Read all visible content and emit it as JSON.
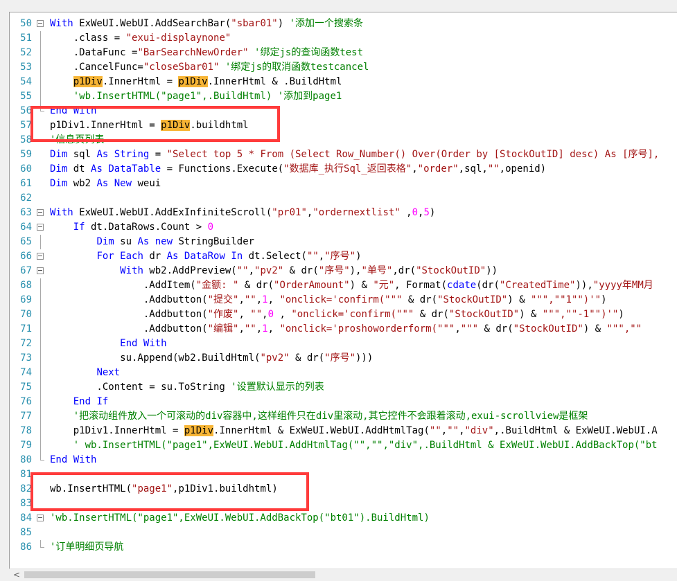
{
  "editor": {
    "lines": [
      {
        "n": "50",
        "fold": "box",
        "segs": [
          {
            "t": "With",
            "c": "kw"
          },
          {
            "t": " ExWeUI.WebUI.AddSearchBar(",
            "c": "pl"
          },
          {
            "t": "\"sbar01\"",
            "c": "str"
          },
          {
            "t": ") ",
            "c": "pl"
          },
          {
            "t": "'添加一个搜索条",
            "c": "com"
          }
        ]
      },
      {
        "n": "51",
        "fold": "line",
        "segs": [
          {
            "t": "    .class = ",
            "c": "pl"
          },
          {
            "t": "\"exui-displaynone\"",
            "c": "str"
          }
        ]
      },
      {
        "n": "52",
        "fold": "line",
        "segs": [
          {
            "t": "    .DataFunc =",
            "c": "pl"
          },
          {
            "t": "\"BarSearchNewOrder\"",
            "c": "str"
          },
          {
            "t": " ",
            "c": "pl"
          },
          {
            "t": "'绑定js的查询函数test",
            "c": "com"
          }
        ]
      },
      {
        "n": "53",
        "fold": "line",
        "segs": [
          {
            "t": "    .CancelFunc=",
            "c": "pl"
          },
          {
            "t": "\"closeSbar01\"",
            "c": "str"
          },
          {
            "t": " ",
            "c": "pl"
          },
          {
            "t": "'绑定js的取消函数testcancel",
            "c": "com"
          }
        ]
      },
      {
        "n": "54",
        "fold": "line",
        "segs": [
          {
            "t": "    ",
            "c": "pl"
          },
          {
            "t": "p1Div",
            "c": "hl"
          },
          {
            "t": ".InnerHtml = ",
            "c": "pl"
          },
          {
            "t": "p1Div",
            "c": "hl"
          },
          {
            "t": ".InnerHtml & .BuildHtml",
            "c": "pl"
          }
        ]
      },
      {
        "n": "55",
        "fold": "line",
        "segs": [
          {
            "t": "    ",
            "c": "pl"
          },
          {
            "t": "'wb.InsertHTML(\"page1\",.BuildHtml) '添加到page1",
            "c": "com"
          }
        ]
      },
      {
        "n": "56",
        "fold": "end",
        "segs": [
          {
            "t": "End",
            "c": "kw"
          },
          {
            "t": " ",
            "c": "pl"
          },
          {
            "t": "With",
            "c": "kw"
          }
        ]
      },
      {
        "n": "57",
        "fold": "none",
        "segs": [
          {
            "t": "p1Div1.InnerHtml = ",
            "c": "pl"
          },
          {
            "t": "p1Div",
            "c": "hl"
          },
          {
            "t": ".buildhtml",
            "c": "pl"
          }
        ]
      },
      {
        "n": "58",
        "fold": "none",
        "segs": [
          {
            "t": "'信息页列表",
            "c": "com"
          }
        ]
      },
      {
        "n": "59",
        "fold": "none",
        "segs": [
          {
            "t": "Dim",
            "c": "kw"
          },
          {
            "t": " sql ",
            "c": "pl"
          },
          {
            "t": "As",
            "c": "kw"
          },
          {
            "t": " ",
            "c": "pl"
          },
          {
            "t": "String",
            "c": "kw"
          },
          {
            "t": " = ",
            "c": "pl"
          },
          {
            "t": "\"Select top 5 * From (Select Row_Number() Over(Order by [StockOutID] desc) As [序号],",
            "c": "str"
          }
        ]
      },
      {
        "n": "60",
        "fold": "none",
        "segs": [
          {
            "t": "Dim",
            "c": "kw"
          },
          {
            "t": " dt ",
            "c": "pl"
          },
          {
            "t": "As",
            "c": "kw"
          },
          {
            "t": " ",
            "c": "pl"
          },
          {
            "t": "DataTable",
            "c": "kw"
          },
          {
            "t": " = Functions.Execute(",
            "c": "pl"
          },
          {
            "t": "\"数据库_执行Sql_返回表格\"",
            "c": "str"
          },
          {
            "t": ",",
            "c": "pl"
          },
          {
            "t": "\"order\"",
            "c": "str"
          },
          {
            "t": ",sql,",
            "c": "pl"
          },
          {
            "t": "\"\"",
            "c": "str"
          },
          {
            "t": ",openid)",
            "c": "pl"
          }
        ]
      },
      {
        "n": "61",
        "fold": "none",
        "segs": [
          {
            "t": "Dim",
            "c": "kw"
          },
          {
            "t": " wb2 ",
            "c": "pl"
          },
          {
            "t": "As",
            "c": "kw"
          },
          {
            "t": " ",
            "c": "pl"
          },
          {
            "t": "New",
            "c": "kw"
          },
          {
            "t": " weui",
            "c": "pl"
          }
        ]
      },
      {
        "n": "62",
        "fold": "none",
        "segs": []
      },
      {
        "n": "63",
        "fold": "box",
        "segs": [
          {
            "t": "With",
            "c": "kw"
          },
          {
            "t": " ExWeUI.WebUI.AddExInfiniteScroll(",
            "c": "pl"
          },
          {
            "t": "\"pr01\"",
            "c": "str"
          },
          {
            "t": ",",
            "c": "pl"
          },
          {
            "t": "\"ordernextlist\"",
            "c": "str"
          },
          {
            "t": " ,",
            "c": "pl"
          },
          {
            "t": "0",
            "c": "num"
          },
          {
            "t": ",",
            "c": "pl"
          },
          {
            "t": "5",
            "c": "num"
          },
          {
            "t": ")",
            "c": "pl"
          }
        ]
      },
      {
        "n": "64",
        "fold": "box",
        "segs": [
          {
            "t": "    ",
            "c": "pl"
          },
          {
            "t": "If",
            "c": "kw"
          },
          {
            "t": " dt.DataRows.Count > ",
            "c": "pl"
          },
          {
            "t": "0",
            "c": "num"
          }
        ]
      },
      {
        "n": "65",
        "fold": "line",
        "segs": [
          {
            "t": "        ",
            "c": "pl"
          },
          {
            "t": "Dim",
            "c": "kw"
          },
          {
            "t": " su ",
            "c": "pl"
          },
          {
            "t": "As",
            "c": "kw"
          },
          {
            "t": " ",
            "c": "pl"
          },
          {
            "t": "new",
            "c": "kw"
          },
          {
            "t": " StringBuilder",
            "c": "pl"
          }
        ]
      },
      {
        "n": "66",
        "fold": "box",
        "segs": [
          {
            "t": "        ",
            "c": "pl"
          },
          {
            "t": "For",
            "c": "kw"
          },
          {
            "t": " ",
            "c": "pl"
          },
          {
            "t": "Each",
            "c": "kw"
          },
          {
            "t": " dr ",
            "c": "pl"
          },
          {
            "t": "As",
            "c": "kw"
          },
          {
            "t": " ",
            "c": "pl"
          },
          {
            "t": "DataRow",
            "c": "kw"
          },
          {
            "t": " ",
            "c": "pl"
          },
          {
            "t": "In",
            "c": "kw"
          },
          {
            "t": " dt.Select(",
            "c": "pl"
          },
          {
            "t": "\"\"",
            "c": "str"
          },
          {
            "t": ",",
            "c": "pl"
          },
          {
            "t": "\"序号\"",
            "c": "str"
          },
          {
            "t": ")",
            "c": "pl"
          }
        ]
      },
      {
        "n": "67",
        "fold": "box",
        "segs": [
          {
            "t": "            ",
            "c": "pl"
          },
          {
            "t": "With",
            "c": "kw"
          },
          {
            "t": " wb2.AddPreview(",
            "c": "pl"
          },
          {
            "t": "\"\"",
            "c": "str"
          },
          {
            "t": ",",
            "c": "pl"
          },
          {
            "t": "\"pv2\"",
            "c": "str"
          },
          {
            "t": " & dr(",
            "c": "pl"
          },
          {
            "t": "\"序号\"",
            "c": "str"
          },
          {
            "t": "),",
            "c": "pl"
          },
          {
            "t": "\"单号\"",
            "c": "str"
          },
          {
            "t": ",dr(",
            "c": "pl"
          },
          {
            "t": "\"StockOutID\"",
            "c": "str"
          },
          {
            "t": "))",
            "c": "pl"
          }
        ]
      },
      {
        "n": "68",
        "fold": "line",
        "segs": [
          {
            "t": "                .AddItem(",
            "c": "pl"
          },
          {
            "t": "\"金额: \"",
            "c": "str"
          },
          {
            "t": " & dr(",
            "c": "pl"
          },
          {
            "t": "\"OrderAmount\"",
            "c": "str"
          },
          {
            "t": ") & ",
            "c": "pl"
          },
          {
            "t": "\"元\"",
            "c": "str"
          },
          {
            "t": ", Format(",
            "c": "pl"
          },
          {
            "t": "cdate",
            "c": "kw"
          },
          {
            "t": "(dr(",
            "c": "pl"
          },
          {
            "t": "\"CreatedTime\"",
            "c": "str"
          },
          {
            "t": ")),",
            "c": "pl"
          },
          {
            "t": "\"yyyy年MM月",
            "c": "str"
          }
        ]
      },
      {
        "n": "69",
        "fold": "line",
        "segs": [
          {
            "t": "                .Addbutton(",
            "c": "pl"
          },
          {
            "t": "\"提交\"",
            "c": "str"
          },
          {
            "t": ",",
            "c": "pl"
          },
          {
            "t": "\"\"",
            "c": "str"
          },
          {
            "t": ",",
            "c": "pl"
          },
          {
            "t": "1",
            "c": "num"
          },
          {
            "t": ", ",
            "c": "pl"
          },
          {
            "t": "\"onclick='confirm(\"\"\"",
            "c": "str"
          },
          {
            "t": " & dr(",
            "c": "pl"
          },
          {
            "t": "\"StockOutID\"",
            "c": "str"
          },
          {
            "t": ") & ",
            "c": "pl"
          },
          {
            "t": "\"\"\",\"\"1\"\")'\"",
            "c": "str"
          },
          {
            "t": ")",
            "c": "pl"
          }
        ]
      },
      {
        "n": "70",
        "fold": "line",
        "segs": [
          {
            "t": "                .Addbutton(",
            "c": "pl"
          },
          {
            "t": "\"作废\"",
            "c": "str"
          },
          {
            "t": ", ",
            "c": "pl"
          },
          {
            "t": "\"\"",
            "c": "str"
          },
          {
            "t": ",",
            "c": "pl"
          },
          {
            "t": "0",
            "c": "num"
          },
          {
            "t": " , ",
            "c": "pl"
          },
          {
            "t": "\"onclick='confirm(\"\"\"",
            "c": "str"
          },
          {
            "t": " & dr(",
            "c": "pl"
          },
          {
            "t": "\"StockOutID\"",
            "c": "str"
          },
          {
            "t": ") & ",
            "c": "pl"
          },
          {
            "t": "\"\"\",\"\"-1\"\")'\"",
            "c": "str"
          },
          {
            "t": ")",
            "c": "pl"
          }
        ]
      },
      {
        "n": "71",
        "fold": "line",
        "segs": [
          {
            "t": "                .Addbutton(",
            "c": "pl"
          },
          {
            "t": "\"编辑\"",
            "c": "str"
          },
          {
            "t": ",",
            "c": "pl"
          },
          {
            "t": "\"\"",
            "c": "str"
          },
          {
            "t": ",",
            "c": "pl"
          },
          {
            "t": "1",
            "c": "num"
          },
          {
            "t": ", ",
            "c": "pl"
          },
          {
            "t": "\"onclick='proshoworderform(\"\"\"",
            "c": "str"
          },
          {
            "t": ",",
            "c": "pl"
          },
          {
            "t": "\"\"\"",
            "c": "str"
          },
          {
            "t": " & dr(",
            "c": "pl"
          },
          {
            "t": "\"StockOutID\"",
            "c": "str"
          },
          {
            "t": ") & ",
            "c": "pl"
          },
          {
            "t": "\"\"\",\"\"",
            "c": "str"
          }
        ]
      },
      {
        "n": "72",
        "fold": "line",
        "segs": [
          {
            "t": "            ",
            "c": "pl"
          },
          {
            "t": "End",
            "c": "kw"
          },
          {
            "t": " ",
            "c": "pl"
          },
          {
            "t": "With",
            "c": "kw"
          }
        ]
      },
      {
        "n": "73",
        "fold": "line",
        "segs": [
          {
            "t": "            su.Append(wb2.BuildHtml(",
            "c": "pl"
          },
          {
            "t": "\"pv2\"",
            "c": "str"
          },
          {
            "t": " & dr(",
            "c": "pl"
          },
          {
            "t": "\"序号\"",
            "c": "str"
          },
          {
            "t": ")))",
            "c": "pl"
          }
        ]
      },
      {
        "n": "74",
        "fold": "line",
        "segs": [
          {
            "t": "        ",
            "c": "pl"
          },
          {
            "t": "Next",
            "c": "kw"
          }
        ]
      },
      {
        "n": "75",
        "fold": "line",
        "segs": [
          {
            "t": "        .Content = su.ToString ",
            "c": "pl"
          },
          {
            "t": "'设置默认显示的列表",
            "c": "com"
          }
        ]
      },
      {
        "n": "76",
        "fold": "line",
        "segs": [
          {
            "t": "    ",
            "c": "pl"
          },
          {
            "t": "End",
            "c": "kw"
          },
          {
            "t": " ",
            "c": "pl"
          },
          {
            "t": "If",
            "c": "kw"
          }
        ]
      },
      {
        "n": "77",
        "fold": "line",
        "segs": [
          {
            "t": "    ",
            "c": "pl"
          },
          {
            "t": "'把滚动组件放入一个可滚动的div容器中,这样组件只在div里滚动,其它控件不会跟着滚动,exui-scrollview是框架",
            "c": "com"
          }
        ]
      },
      {
        "n": "78",
        "fold": "line",
        "segs": [
          {
            "t": "    p1Div1.InnerHtml = ",
            "c": "pl"
          },
          {
            "t": "p1Div",
            "c": "hl"
          },
          {
            "t": ".InnerHtml & ExWeUI.WebUI.AddHtmlTag(",
            "c": "pl"
          },
          {
            "t": "\"\"",
            "c": "str"
          },
          {
            "t": ",",
            "c": "pl"
          },
          {
            "t": "\"\"",
            "c": "str"
          },
          {
            "t": ",",
            "c": "pl"
          },
          {
            "t": "\"div\"",
            "c": "str"
          },
          {
            "t": ",.BuildHtml & ExWeUI.WebUI.A",
            "c": "pl"
          }
        ]
      },
      {
        "n": "79",
        "fold": "line",
        "segs": [
          {
            "t": "    ",
            "c": "pl"
          },
          {
            "t": "' wb.InsertHTML(\"page1\",ExWeUI.WebUI.AddHtmlTag(\"\",\"\",\"div\",.BuildHtml & ExWeUI.WebUI.AddBackTop(\"bt",
            "c": "com"
          }
        ]
      },
      {
        "n": "80",
        "fold": "end",
        "segs": [
          {
            "t": "End",
            "c": "kw"
          },
          {
            "t": " ",
            "c": "pl"
          },
          {
            "t": "With",
            "c": "kw"
          }
        ]
      },
      {
        "n": "81",
        "fold": "none",
        "segs": []
      },
      {
        "n": "82",
        "fold": "none",
        "segs": [
          {
            "t": "wb.InsertHTML(",
            "c": "pl"
          },
          {
            "t": "\"page1\"",
            "c": "str"
          },
          {
            "t": ",p1Div1.buildhtml)",
            "c": "pl"
          }
        ]
      },
      {
        "n": "83",
        "fold": "none",
        "segs": []
      },
      {
        "n": "84",
        "fold": "box",
        "segs": [
          {
            "t": "'wb.InsertHTML(\"page1\",ExWeUI.WebUI.AddBackTop(\"bt01\").BuildHtml)",
            "c": "com"
          }
        ]
      },
      {
        "n": "85",
        "fold": "none",
        "segs": []
      },
      {
        "n": "86",
        "fold": "end",
        "segs": [
          {
            "t": "'订单明细页导航",
            "c": "com"
          }
        ]
      }
    ]
  },
  "scrollbar": {
    "left_arrow": "<"
  },
  "colors": {
    "keyword": "#0000ff",
    "string": "#a31515",
    "comment": "#008000",
    "number": "#ff00ff",
    "highlight": "#f7b536",
    "annotation_box": "#ff3b3b",
    "line_number": "#2b91af"
  }
}
